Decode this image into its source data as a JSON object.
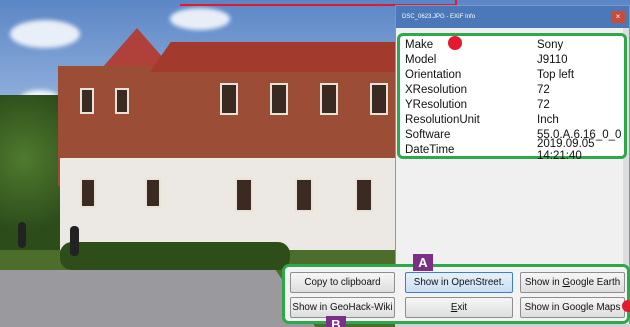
{
  "exif_window": {
    "title": "DSC_0623.JPG - EXIF Info",
    "close_label": "×"
  },
  "metadata": [
    {
      "key": "Make",
      "value": "Sony"
    },
    {
      "key": "Model",
      "value": "J9110"
    },
    {
      "key": "Orientation",
      "value": "Top left"
    },
    {
      "key": "XResolution",
      "value": "72"
    },
    {
      "key": "YResolution",
      "value": "72"
    },
    {
      "key": "ResolutionUnit",
      "value": "Inch"
    },
    {
      "key": "Software",
      "value": "55.0.A.6.16_0_0"
    },
    {
      "key": "DateTime",
      "value": "2019.09.05 14:21:40"
    }
  ],
  "buttons": {
    "copy": "Copy to clipboard",
    "openstreet": "Show in OpenStreet.",
    "google_earth_prefix": "Show in ",
    "google_earth_underlined": "G",
    "google_earth_suffix": "oogle Earth",
    "geohack": "Show in GeoHack-Wiki",
    "exit_underlined": "E",
    "exit_suffix": "xit",
    "google_maps": "Show in Google Maps"
  },
  "badges": {
    "a": "A",
    "b": "B"
  },
  "colors": {
    "highlight_border": "#2ea84a",
    "callout_red": "#e3192d",
    "badge_purple": "#7b2f86"
  }
}
